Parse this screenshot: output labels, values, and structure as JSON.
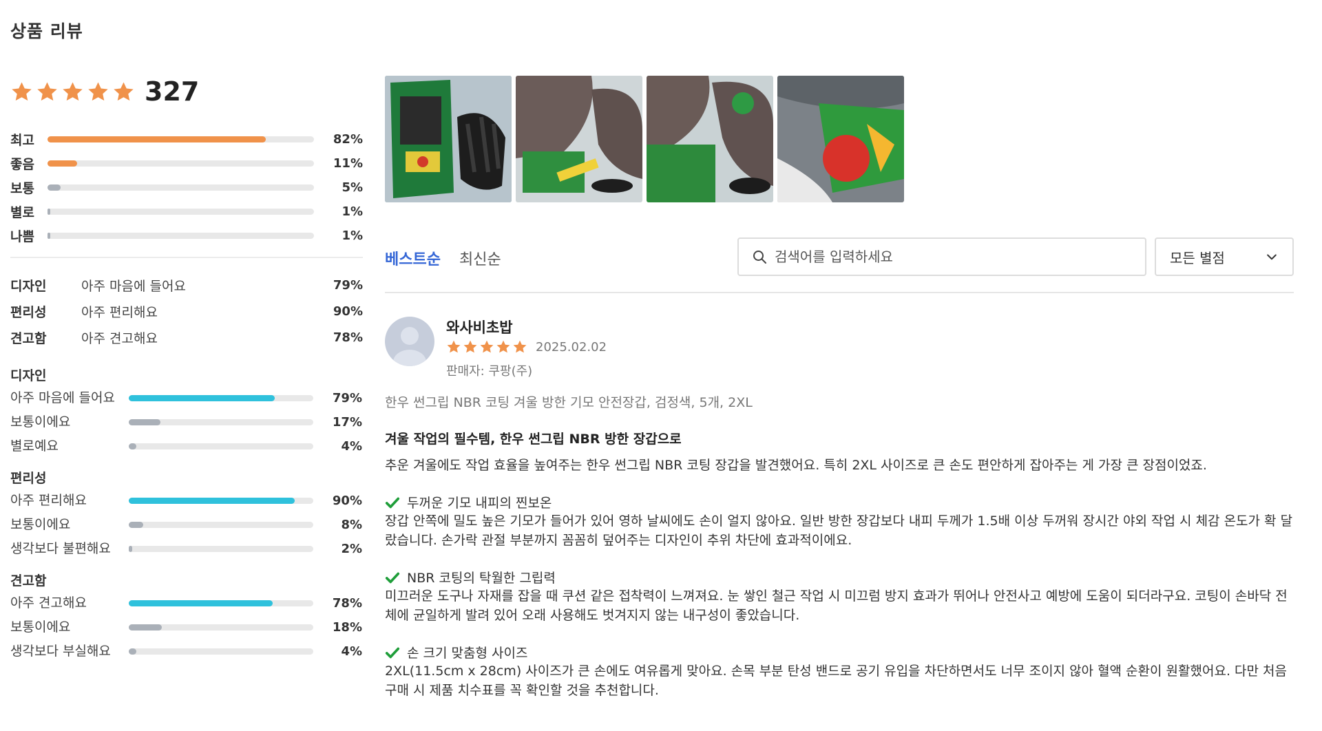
{
  "header": {
    "title": "상품 리뷰"
  },
  "rating": {
    "stars": 5,
    "count": "327"
  },
  "distribution": [
    {
      "label": "최고",
      "value": 82,
      "pct": "82%",
      "color": "orange"
    },
    {
      "label": "좋음",
      "value": 11,
      "pct": "11%",
      "color": "orange"
    },
    {
      "label": "보통",
      "value": 5,
      "pct": "5%",
      "color": "gray"
    },
    {
      "label": "별로",
      "value": 1,
      "pct": "1%",
      "color": "gray"
    },
    {
      "label": "나쁨",
      "value": 1,
      "pct": "1%",
      "color": "gray"
    }
  ],
  "summary": [
    {
      "category": "디자인",
      "value": "아주 마음에 들어요",
      "pct": "79%"
    },
    {
      "category": "편리성",
      "value": "아주 편리해요",
      "pct": "90%"
    },
    {
      "category": "견고함",
      "value": "아주 견고해요",
      "pct": "78%"
    }
  ],
  "details": [
    {
      "title": "디자인",
      "rows": [
        {
          "label": "아주 마음에 들어요",
          "value": 79,
          "pct": "79%",
          "color": "cyan"
        },
        {
          "label": "보통이에요",
          "value": 17,
          "pct": "17%",
          "color": "gray"
        },
        {
          "label": "별로예요",
          "value": 4,
          "pct": "4%",
          "color": "gray"
        }
      ]
    },
    {
      "title": "편리성",
      "rows": [
        {
          "label": "아주 편리해요",
          "value": 90,
          "pct": "90%",
          "color": "cyan"
        },
        {
          "label": "보통이에요",
          "value": 8,
          "pct": "8%",
          "color": "gray"
        },
        {
          "label": "생각보다 불편해요",
          "value": 2,
          "pct": "2%",
          "color": "gray"
        }
      ]
    },
    {
      "title": "견고함",
      "rows": [
        {
          "label": "아주 견고해요",
          "value": 78,
          "pct": "78%",
          "color": "cyan"
        },
        {
          "label": "보통이에요",
          "value": 18,
          "pct": "18%",
          "color": "gray"
        },
        {
          "label": "생각보다 부실해요",
          "value": 4,
          "pct": "4%",
          "color": "gray"
        }
      ]
    }
  ],
  "sort": {
    "best": "베스트순",
    "newest": "최신순"
  },
  "search": {
    "placeholder": "검색어를 입력하세요"
  },
  "filter": {
    "selected": "모든 별점"
  },
  "review": {
    "name": "와사비초밥",
    "stars": 5,
    "date": "2025.02.02",
    "seller": "판매자: 쿠팡(주)",
    "option": "한우 썬그립 NBR 코팅 겨울 방한 기모 안전장갑, 검정색, 5개, 2XL",
    "title": "겨울 작업의 필수템, 한우 썬그립 NBR 방한 장갑으로",
    "intro": "추운 겨울에도 작업 효율을 높여주는 한우 썬그립 NBR 코팅 장갑을 발견했어요. 특히 2XL 사이즈로 큰 손도 편안하게 잡아주는 게 가장 큰 장점이었죠.",
    "sections": [
      {
        "heading": "두꺼운 기모 내피의 찐보온",
        "body": "장갑 안쪽에 밀도 높은 기모가 들어가 있어 영하 날씨에도 손이 얼지 않아요. 일반 방한 장갑보다 내피 두께가 1.5배 이상 두꺼워 장시간 야외 작업 시 체감 온도가 확 달랐습니다. 손가락 관절 부분까지 꼼꼼히 덮어주는 디자인이 추위 차단에 효과적이에요."
      },
      {
        "heading": "NBR 코팅의 탁월한 그립력",
        "body": "미끄러운 도구나 자재를 잡을 때 쿠션 같은 접착력이 느껴져요. 눈 쌓인 철근 작업 시 미끄럼 방지 효과가 뛰어나 안전사고 예방에 도움이 되더라구요. 코팅이 손바닥 전체에 균일하게 발려 있어 오래 사용해도 벗겨지지 않는 내구성이 좋았습니다."
      },
      {
        "heading": "손 크기 맞춤형 사이즈",
        "body": "2XL(11.5cm x 28cm) 사이즈가 큰 손에도 여유롭게 맞아요. 손목 부분 탄성 밴드로 공기 유입을 차단하면서도 너무 조이지 않아 혈액 순환이 원활했어요. 다만 처음 구매 시 제품 치수표를 꼭 확인할 것을 추천합니다."
      }
    ]
  },
  "photos": [
    {
      "name": "review-photo-1"
    },
    {
      "name": "review-photo-2"
    },
    {
      "name": "review-photo-3"
    },
    {
      "name": "review-photo-4"
    }
  ],
  "colors": {
    "star": "#f0924a",
    "orange_bar": "#f0924a",
    "cyan_bar": "#2fc1dc",
    "gray_bar": "#aab0b8",
    "accent_blue": "#3466d6",
    "check_green": "#1f9e3a"
  },
  "icons": {
    "search": "search-icon",
    "chevron": "chevron-down-icon",
    "check": "check-icon",
    "star": "star-icon"
  }
}
